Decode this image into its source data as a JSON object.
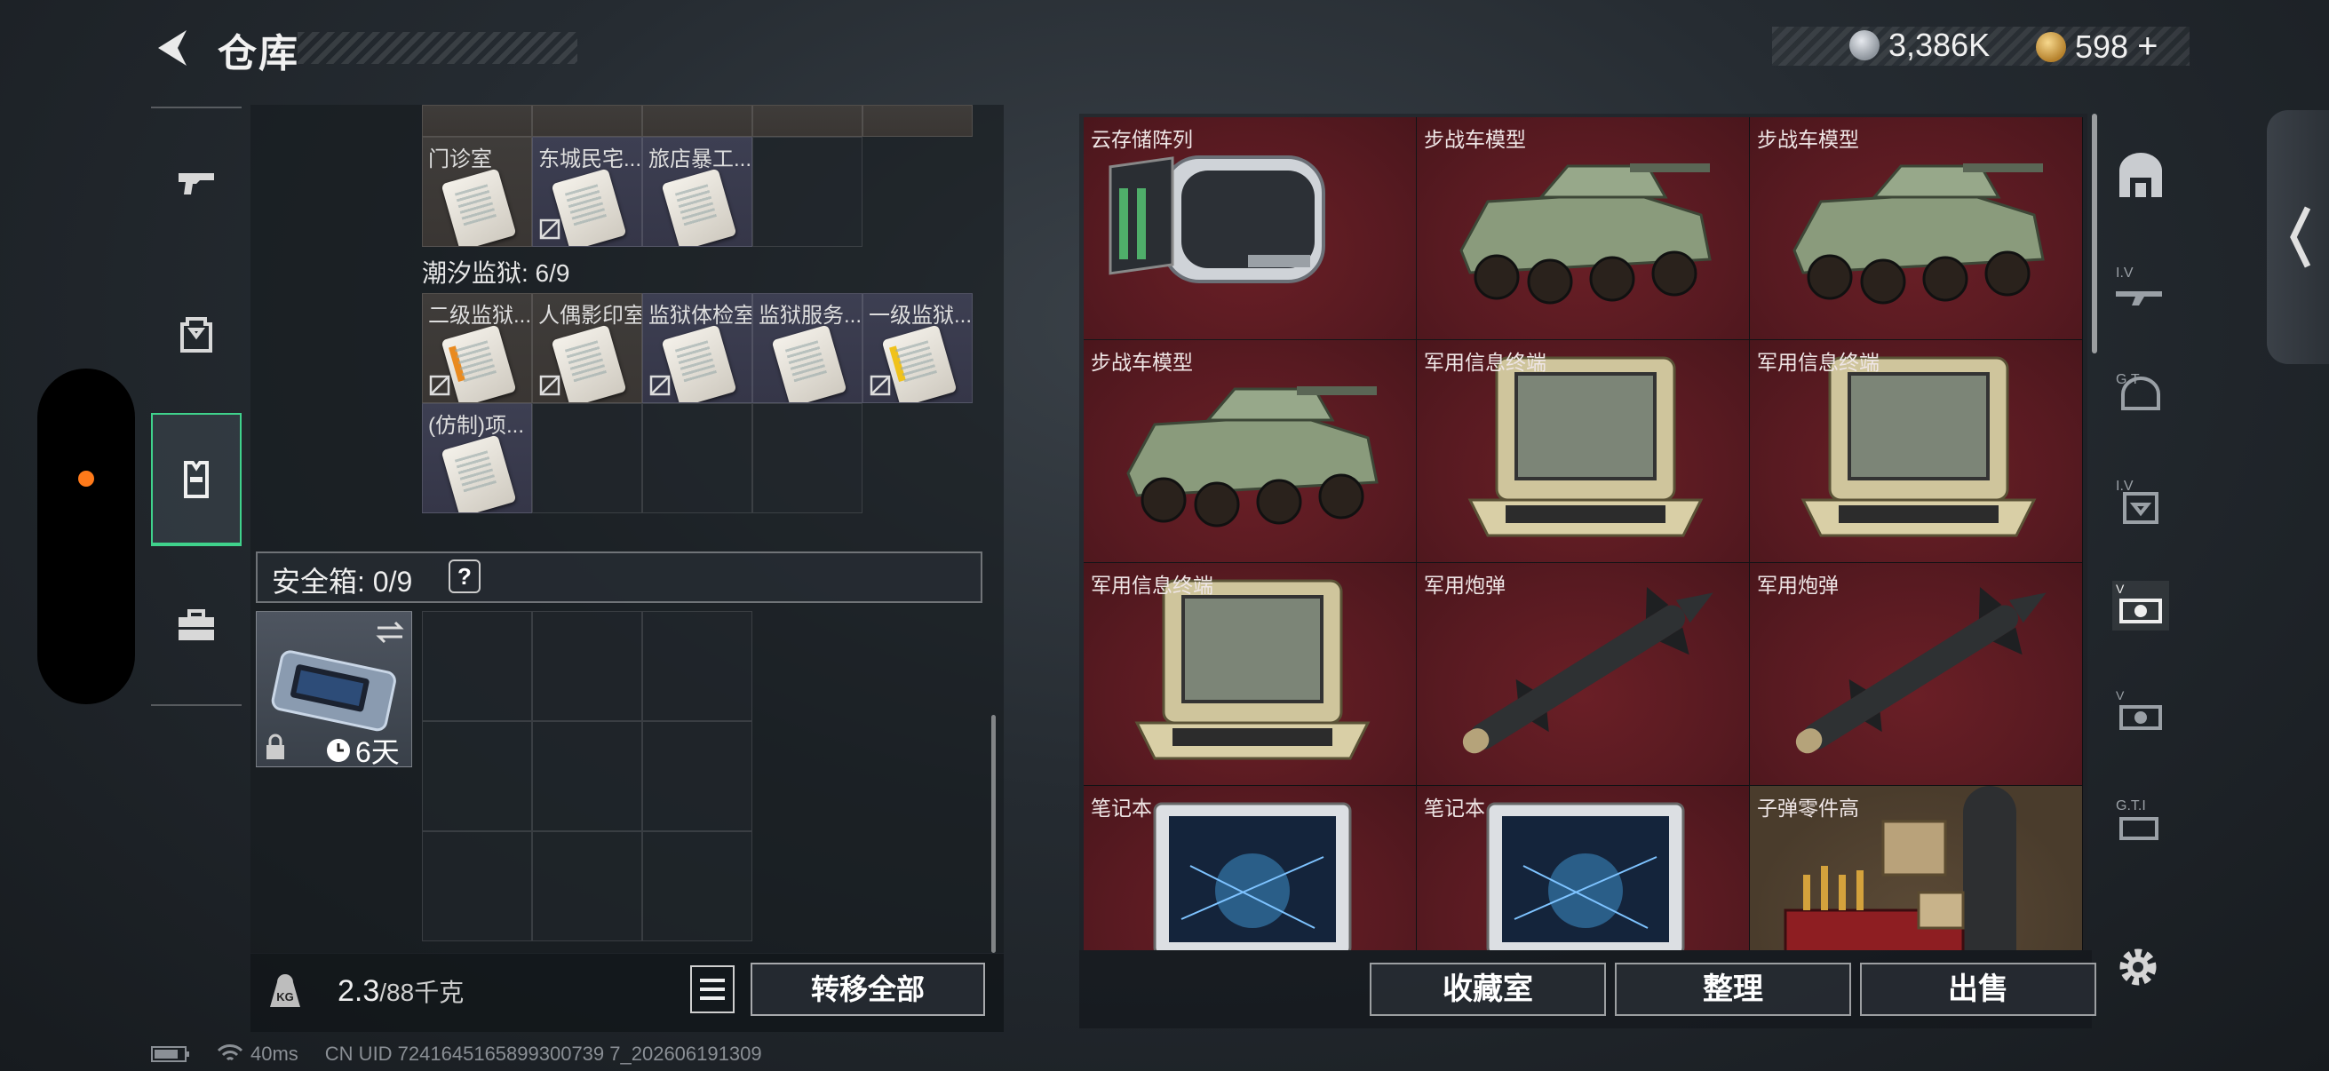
{
  "header": {
    "title": "仓库",
    "back_icon": "back-arrow-icon",
    "currencies": [
      {
        "icon": "silver-coin-icon",
        "value": "3,386K",
        "color": "#b8bec6"
      },
      {
        "icon": "gold-coin-icon",
        "value": "598",
        "add": "+",
        "color": "#d6a548"
      }
    ]
  },
  "category_tabs": [
    {
      "icon": "pistol-icon",
      "active": false
    },
    {
      "icon": "backpack-icon",
      "active": false
    },
    {
      "icon": "chest-rig-icon",
      "active": true
    },
    {
      "icon": "toolbox-icon",
      "active": false
    }
  ],
  "keys_section": {
    "row_a": [
      {
        "name": "门诊室",
        "linked": true
      },
      {
        "name": "东城民宅...",
        "linked": false
      },
      {
        "name": "旅店暴工...",
        "linked": true
      },
      {
        "name": "",
        "linked": true
      },
      {
        "name": "",
        "linked": true
      }
    ],
    "group_title": "潮汐监狱: 6/9",
    "row_b": [
      {
        "name": "二级监狱...",
        "accent": "orange",
        "linked": false
      },
      {
        "name": "人偶影印室",
        "linked": false
      },
      {
        "name": "监狱体检室",
        "linked": false
      },
      {
        "name": "监狱服务...",
        "linked": true
      },
      {
        "name": "一级监狱...",
        "accent": "yellow",
        "linked": false
      }
    ],
    "row_c": [
      {
        "name": "(仿制)项...",
        "linked": true
      }
    ]
  },
  "safe_box": {
    "label": "安全箱: 0/9",
    "help": "?",
    "timer": "6天",
    "swap_icon": "swap-icon",
    "lock_icon": "lock-icon",
    "clock_icon": "clock-icon"
  },
  "bottom_left": {
    "weight": "2.3",
    "weight_max": "/88千克",
    "weight_icon": "kg-weight-icon",
    "list_icon": "list-icon",
    "transfer_label": "转移全部"
  },
  "stash_items": [
    {
      "name": "云存储阵列",
      "art": "server"
    },
    {
      "name": "步战车模型",
      "art": "ifv"
    },
    {
      "name": "步战车模型",
      "art": "ifv"
    },
    {
      "name": "步战车模型",
      "art": "ifv"
    },
    {
      "name": "军用信息终端",
      "art": "terminal"
    },
    {
      "name": "军用信息终端",
      "art": "terminal"
    },
    {
      "name": "军用信息终端",
      "art": "terminal"
    },
    {
      "name": "军用炮弹",
      "art": "missile"
    },
    {
      "name": "军用炮弹",
      "art": "missile"
    },
    {
      "name": "笔记本",
      "art": "laptop"
    },
    {
      "name": "笔记本",
      "art": "laptop"
    },
    {
      "name": "子弹零件高",
      "art": "ammo",
      "rarity": "brown"
    }
  ],
  "filter_icons": [
    "shelter-icon",
    "rifle-filter-icon",
    "helmet-filter-icon",
    "armor-filter-icon",
    "valuables-filter-icon",
    "ammo-filter-icon",
    "parts-filter-icon"
  ],
  "stash_buttons": [
    "收藏室",
    "整理",
    "出售"
  ],
  "settings_icon": "gear-icon",
  "status": {
    "ping": "40ms",
    "uid": "CN UID 7241645165899300739 7_202606191309"
  }
}
